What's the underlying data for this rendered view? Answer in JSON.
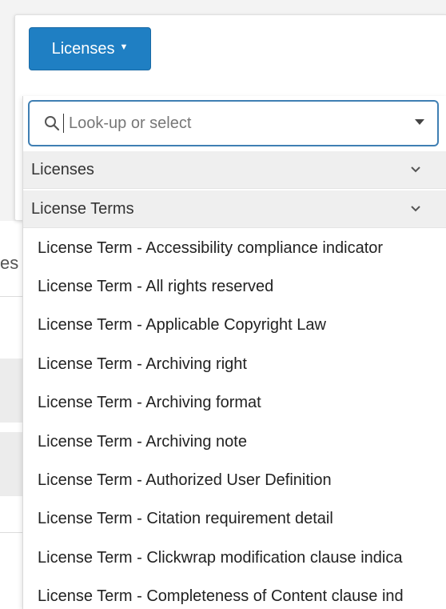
{
  "toolbar": {
    "licenses_button_label": "Licenses",
    "licenses_button_caret": "▼"
  },
  "background": {
    "fragment_text": "es"
  },
  "dropdown": {
    "search_placeholder": "Look-up or select",
    "search_value": "",
    "groups": [
      {
        "label": "Licenses",
        "collapsed": true
      },
      {
        "label": "License Terms",
        "collapsed": false
      }
    ],
    "options": [
      "License Term - Accessibility compliance indicator",
      "License Term - All rights reserved",
      "License Term - Applicable Copyright Law",
      "License Term - Archiving right",
      "License Term - Archiving format",
      "License Term - Archiving note",
      "License Term - Authorized User Definition",
      "License Term - Citation requirement detail",
      "License Term - Clickwrap modification clause indica",
      "License Term - Completeness of Content clause ind"
    ]
  },
  "colors": {
    "primary_button": "#1f7fc3",
    "search_border": "#3f7fb3",
    "group_header_bg": "#efefef"
  },
  "icons": {
    "search": "search-icon",
    "select_caret": "caret-down-icon",
    "group_chevron": "chevron-down-icon"
  }
}
